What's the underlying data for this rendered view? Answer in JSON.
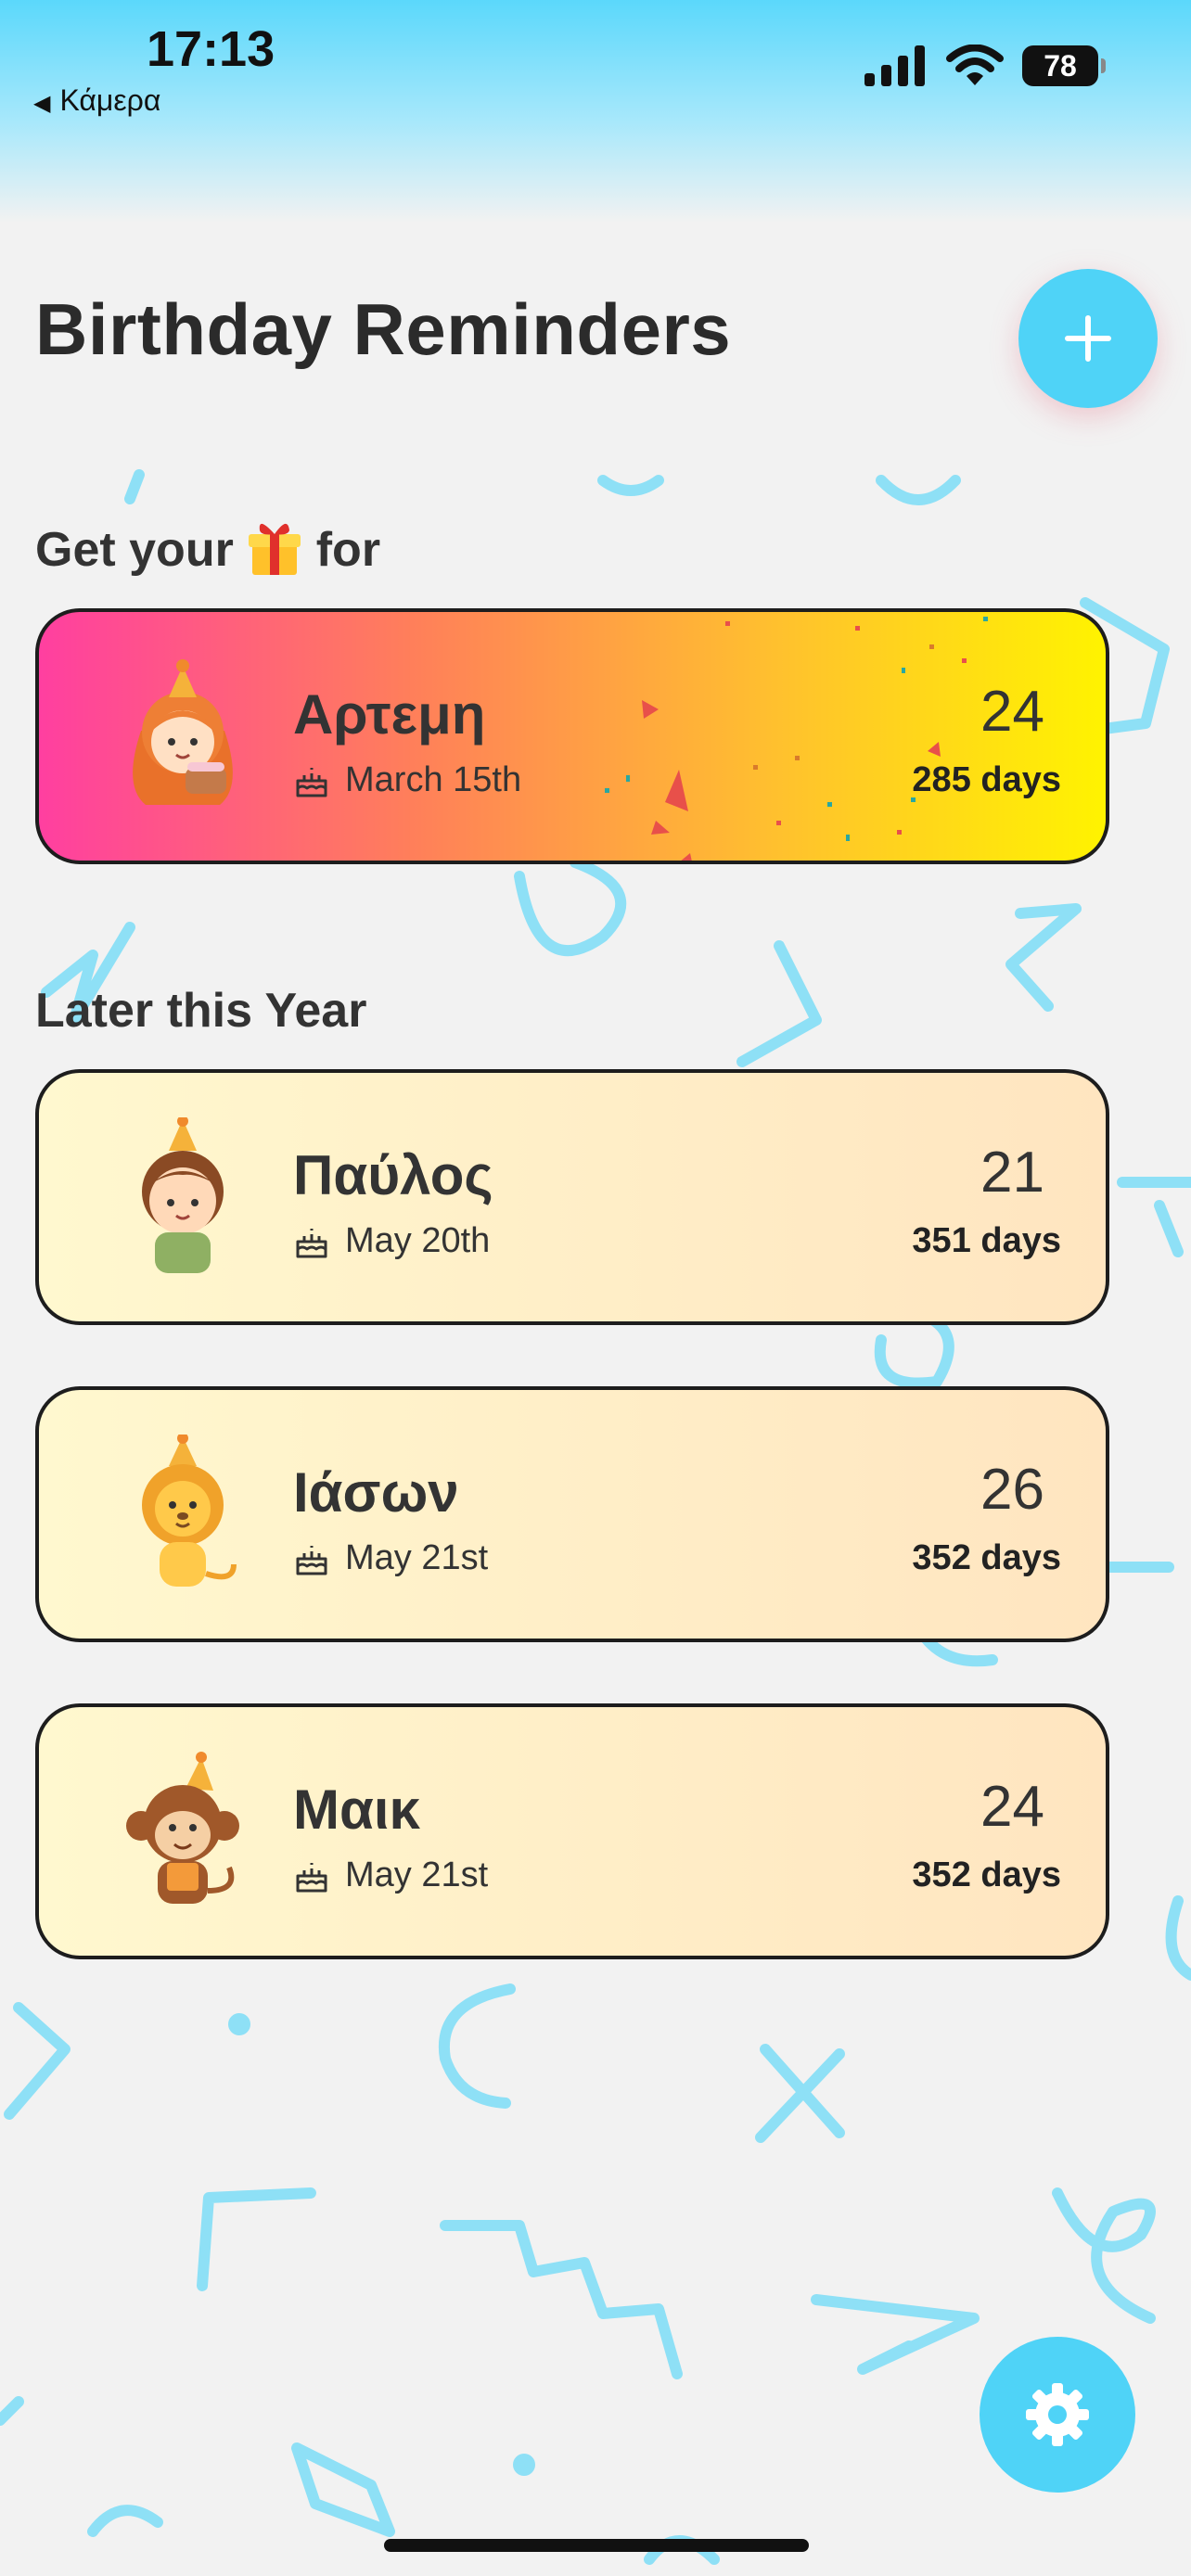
{
  "status_bar": {
    "time": "17:13",
    "back_label": "Κάμερα",
    "battery": "78"
  },
  "header": {
    "title": "Birthday Reminders"
  },
  "next": {
    "label_before": "Get your",
    "label_after": "for",
    "person": {
      "name": "Αρτεμη",
      "date": "March 15th",
      "age": "24",
      "days": "285 days"
    }
  },
  "later": {
    "label": "Later this Year",
    "items": [
      {
        "name": "Παύλος",
        "date": "May 20th",
        "age": "21",
        "days": "351 days"
      },
      {
        "name": "Ιάσων",
        "date": "May 21st",
        "age": "26",
        "days": "352 days"
      },
      {
        "name": "Μαικ",
        "date": "May 21st",
        "age": "24",
        "days": "352 days"
      }
    ]
  },
  "colors": {
    "accent": "#4fd3f7",
    "hero_gradient_start": "#ff3fa0",
    "hero_gradient_end": "#fff300",
    "card_gradient_start": "#fff8cf",
    "card_gradient_end": "#ffe5c0"
  }
}
